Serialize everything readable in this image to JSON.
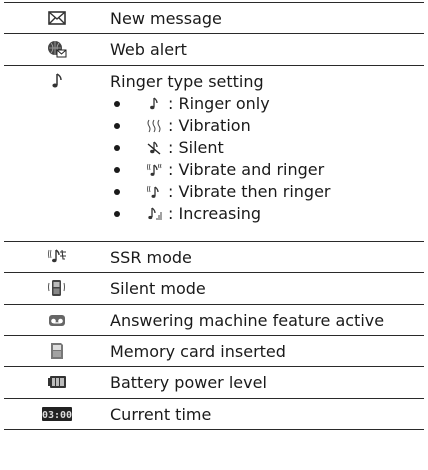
{
  "rows": [
    {
      "icon": "envelope-icon",
      "label": "New message"
    },
    {
      "icon": "web-alert-icon",
      "label": "Web alert"
    },
    {
      "icon": "music-note-icon",
      "label": "Ringer type setting",
      "items": [
        {
          "icon": "music-note-icon",
          "text": ": Ringer only"
        },
        {
          "icon": "vibration-icon",
          "text": ": Vibration"
        },
        {
          "icon": "silent-note-icon",
          "text": ": Silent"
        },
        {
          "icon": "vibrate-ring-icon",
          "text": ": Vibrate and ringer"
        },
        {
          "icon": "vibrate-then-ring-icon",
          "text": ": Vibrate then ringer"
        },
        {
          "icon": "increasing-ring-icon",
          "text": ": Increasing"
        }
      ]
    },
    {
      "icon": "ssr-mode-icon",
      "label": "SSR mode"
    },
    {
      "icon": "silent-mode-phone-icon",
      "label": "Silent mode"
    },
    {
      "icon": "answering-machine-icon",
      "label": "Answering machine feature active"
    },
    {
      "icon": "memory-card-icon",
      "label": "Memory card inserted"
    },
    {
      "icon": "battery-icon",
      "label": "Battery power level"
    },
    {
      "icon": "clock-display-icon",
      "label": "Current time",
      "display": "03:00"
    }
  ]
}
